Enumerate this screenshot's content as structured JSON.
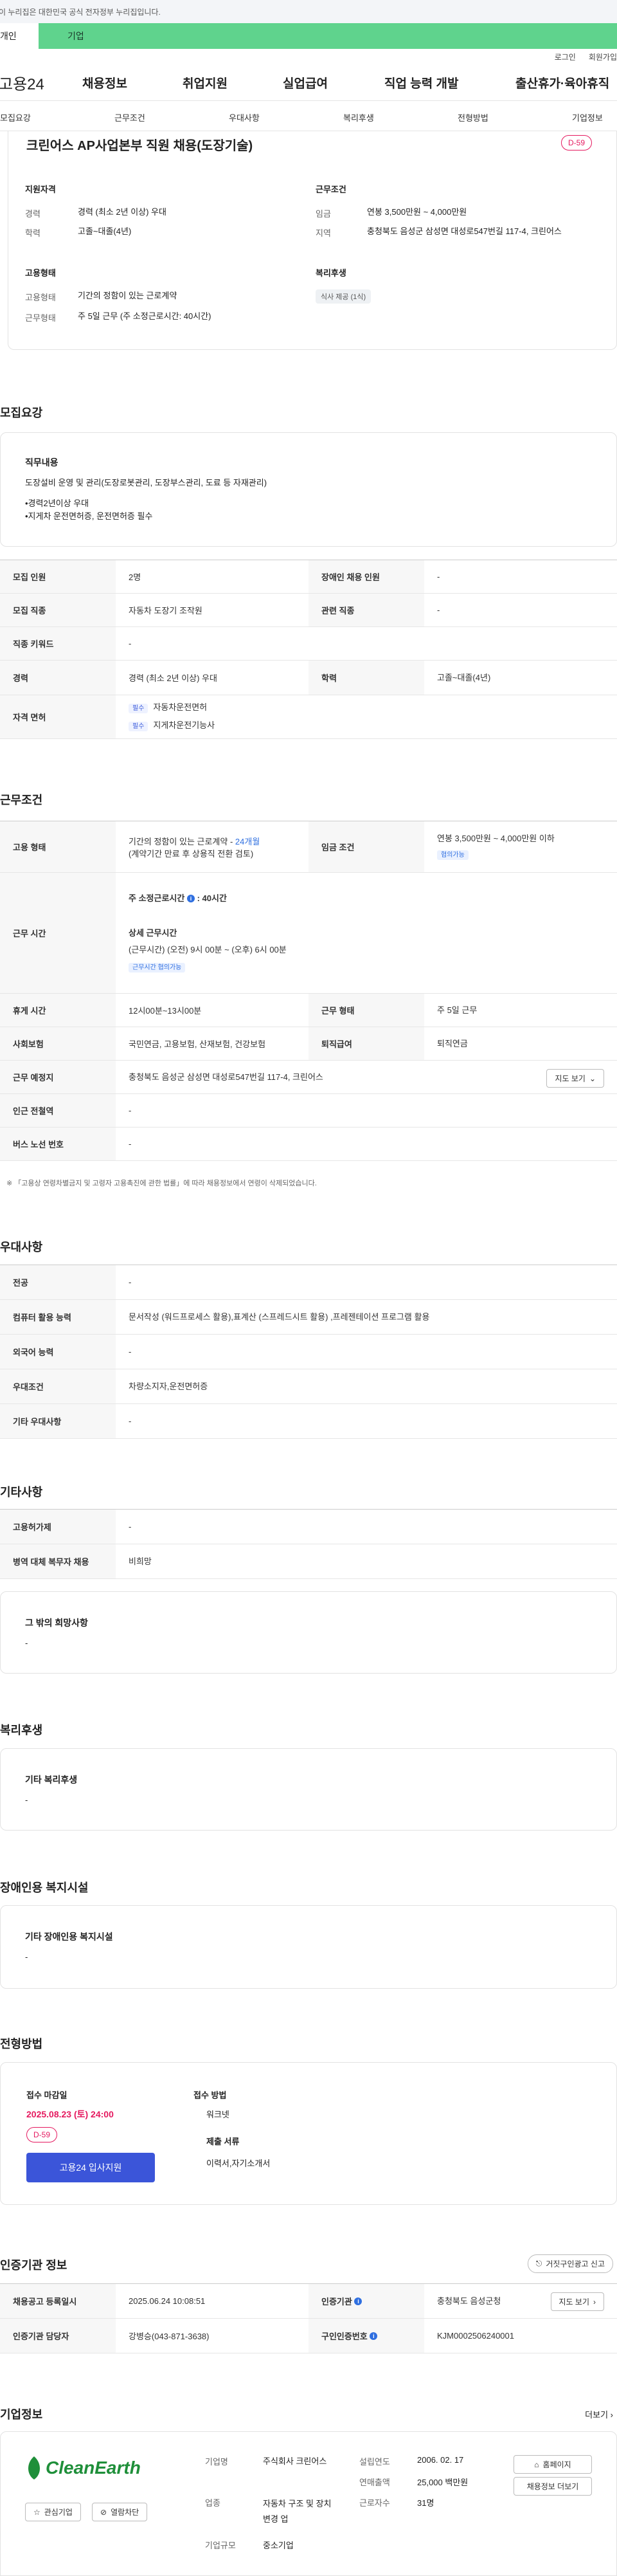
{
  "gov_banner": "이 누리집은 대한민국 공식 전자정부 누리집입니다.",
  "tabs": [
    "개인",
    "기업"
  ],
  "util": [
    "로그인",
    "회원가입"
  ],
  "gnb": {
    "logo": "고용24",
    "items": [
      "채용정보",
      "취업지원",
      "실업급여",
      "직업 능력 개발",
      "출산휴가·육아휴직"
    ]
  },
  "subnav": [
    "모집요강",
    "근무조건",
    "우대사항",
    "복리후생",
    "전형방법",
    "기업정보"
  ],
  "summary": {
    "title": "크린어스 AP사업본부 직원 채용(도장기술)",
    "dday": "D-59",
    "qual_h": "지원자격",
    "qual": [
      {
        "label": "경력",
        "value": "경력 (최소 2년 이상) 우대"
      },
      {
        "label": "학력",
        "value": "고졸~대졸(4년)"
      }
    ],
    "cond_h": "근무조건",
    "cond": [
      {
        "label": "임금",
        "value": "연봉 3,500만원 ~ 4,000만원"
      },
      {
        "label": "지역",
        "value": "충청북도 음성군 삼성면 대성로547번길 117-4, 크린어스"
      }
    ],
    "emp_h": "고용형태",
    "emp": [
      {
        "label": "고용형태",
        "value": "기간의 정함이 있는 근로계약"
      },
      {
        "label": "근무형태",
        "value": "주 5일 근무 (주 소정근로시간: 40시간)"
      }
    ],
    "welfare_h": "복리후생",
    "welfare_badge": "식사 제공 (1식)"
  },
  "recruit": {
    "title": "모집요강",
    "duty_h": "직무내용",
    "duty_lines": [
      "도장설비 운영 및 관리(도장로봇관리, 도장부스관리, 도료 등 자재관리)",
      "",
      "•경력2년이상 우대",
      "•지게차 운전면허증, 운전면허증 필수"
    ],
    "rows": [
      {
        "h1": "모집 인원",
        "v1": "2명",
        "h2": "장애인 채용 인원",
        "v2": "-"
      },
      {
        "h1": "모집 직종",
        "v1": "자동차 도장기 조작원",
        "h2": "관련 직종",
        "v2": "-"
      },
      {
        "h1": "직종 키워드",
        "v1": "-"
      },
      {
        "h1": "경력",
        "v1": "경력 (최소 2년 이상) 우대",
        "h2": "학력",
        "v2": "고졸~대졸(4년)"
      }
    ],
    "license_h": "자격 면허",
    "licenses": [
      {
        "tag": "필수",
        "name": "자동차운전면허"
      },
      {
        "tag": "필수",
        "name": "지게차운전기능사"
      }
    ]
  },
  "work": {
    "title": "근무조건",
    "emp_h": "고용 형태",
    "emp_v1": "기간의 정함이 있는 근로계약 -",
    "emp_v1_blue": "24개월",
    "emp_v2": "(계약기간 만료 후 상용직 전환 검토)",
    "pay_h": "임금 조건",
    "pay_v": "연봉 3,500만원 ~ 4,000만원 이하",
    "pay_badge": "협의가능",
    "hours_h": "근무 시간",
    "hours_title": "주 소정근로시간",
    "hours_val": ": 40시간",
    "hours_detail_h": "상세 근무시간",
    "hours_detail": "(근무시간) (오전) 9시 00분 ~ (오후) 6시 00분",
    "hours_badge": "근무시간 협의가능",
    "rows": [
      {
        "h1": "휴게 시간",
        "v1": "12시00분~13시00분",
        "h2": "근무 형태",
        "v2": "주 5일 근무"
      },
      {
        "h1": "사회보험",
        "v1": "국민연금, 고용보험, 산재보험, 건강보험",
        "h2": "퇴직급여",
        "v2": "퇴직연금"
      }
    ],
    "place_h": "근무 예정지",
    "place_v": "충청북도 음성군 삼성면 대성로547번길 117-4, 크린어스",
    "map_btn": "지도 보기",
    "station_h": "인근 전철역",
    "station_v": "-",
    "bus_h": "버스 노선 번호",
    "bus_v": "-",
    "note": "※ 「고용상 연령차별금지 및 고령자 고용촉진에 관한 법률」에 따라 채용정보에서 연령이 삭제되었습니다."
  },
  "pref": {
    "title": "우대사항",
    "rows": [
      {
        "h": "전공",
        "v": "-"
      },
      {
        "h": "컴퓨터 활용 능력",
        "v": "문서작성 (워드프로세스 활용),표계산 (스프레드시트 활용) ,프레젠테이션 프로그램 활용"
      },
      {
        "h": "외국어 능력",
        "v": "-"
      },
      {
        "h": "우대조건",
        "v": "차량소지자,운전면허증"
      },
      {
        "h": "기타 우대사항",
        "v": "-"
      }
    ]
  },
  "etc": {
    "title": "기타사항",
    "rows": [
      {
        "h": "고용허가제",
        "v": "-"
      },
      {
        "h": "병역 대체 복무자 채용",
        "v": "비희망"
      }
    ],
    "wish_h": "그 밖의 희망사항",
    "wish_v": "-"
  },
  "welfare": {
    "title": "복리후생",
    "h": "기타 복리후생",
    "v": "-"
  },
  "disabled": {
    "title": "장애인용 복지시설",
    "h": "기타 장애인용 복지시설",
    "v": "-"
  },
  "process": {
    "title": "전형방법",
    "deadline_h": "접수 마감일",
    "deadline_v": "2025.08.23 (토) 24:00",
    "dday": "D-59",
    "apply_btn": "고용24 입사지원",
    "method_h": "접수 방법",
    "method_v": "워크넷",
    "docs_h": "제출 서류",
    "docs_v": "이력서,자기소개서"
  },
  "cert": {
    "title": "인증기관 정보",
    "report_btn": "거짓구인광고 신고",
    "rows": [
      {
        "h1": "채용공고 등록일시",
        "v1": "2025.06.24 10:08:51",
        "h2": "인증기관",
        "v2": "충청북도 음성군청"
      },
      {
        "h1": "인증기관 담당자",
        "v1": "강병승(043-871-3638)",
        "h2": "구인인증번호",
        "v2": "KJM0002506240001"
      }
    ],
    "map_btn": "지도 보기"
  },
  "company": {
    "title": "기업정보",
    "more": "더보기",
    "logo_text": "CleanEarth",
    "fav_btn": "관심기업",
    "block_btn": "열람차단",
    "info": [
      {
        "h": "기업명",
        "v": "주식회사 크린어스"
      },
      {
        "h": "업종",
        "v": "자동차 구조 및 장치 변경 업"
      },
      {
        "h": "기업규모",
        "v": "중소기업"
      }
    ],
    "info2": [
      {
        "h": "설립연도",
        "v": "2006. 02. 17"
      },
      {
        "h": "연매출액",
        "v": "25,000 백만원"
      },
      {
        "h": "근로자수",
        "v": "31명"
      }
    ],
    "home_btn": "홈페이지",
    "jobs_btn": "채용정보 더보기"
  }
}
